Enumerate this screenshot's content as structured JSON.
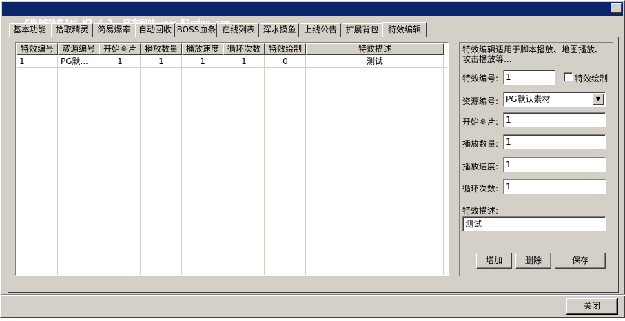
{
  "window": {
    "title": "G盾PG插件3代 V3.4.2  官方网站:www.52gdun.com",
    "close_glyph": "✕"
  },
  "tabs": [
    "基本功能",
    "拾取精灵",
    "简易爆率",
    "自动回收",
    "BOSS血条",
    "在线列表",
    "浑水摸鱼",
    "上线公告",
    "扩展背包",
    "特效编辑"
  ],
  "active_tab": "特效编辑",
  "table": {
    "columns": [
      "特效编号",
      "资源编号",
      "开始图片",
      "播放数量",
      "播放速度",
      "循环次数",
      "特效绘制",
      "特效描述"
    ],
    "rows": [
      [
        "1",
        "PG默...",
        "1",
        "1",
        "1",
        "1",
        "0",
        "测试"
      ]
    ]
  },
  "form": {
    "description": "特效编辑适用于脚本播放、地图播放、攻击播放等...",
    "effect_id_label": "特效编号:",
    "effect_id_value": "1",
    "draw_effect_label": "特效绘制",
    "draw_effect_checked": false,
    "resource_id_label": "资源编号:",
    "resource_id_value": "PG默认素材",
    "start_image_label": "开始图片:",
    "start_image_value": "1",
    "play_count_label": "播放数量:",
    "play_count_value": "1",
    "play_speed_label": "播放速度:",
    "play_speed_value": "1",
    "loop_count_label": "循环次数:",
    "loop_count_value": "1",
    "effect_desc_label": "特效描述:",
    "effect_desc_value": "测试"
  },
  "buttons": {
    "add": "增加",
    "delete": "删除",
    "save": "保存",
    "close": "关闭"
  },
  "icons": {
    "dropdown": "chevron-down-icon"
  }
}
